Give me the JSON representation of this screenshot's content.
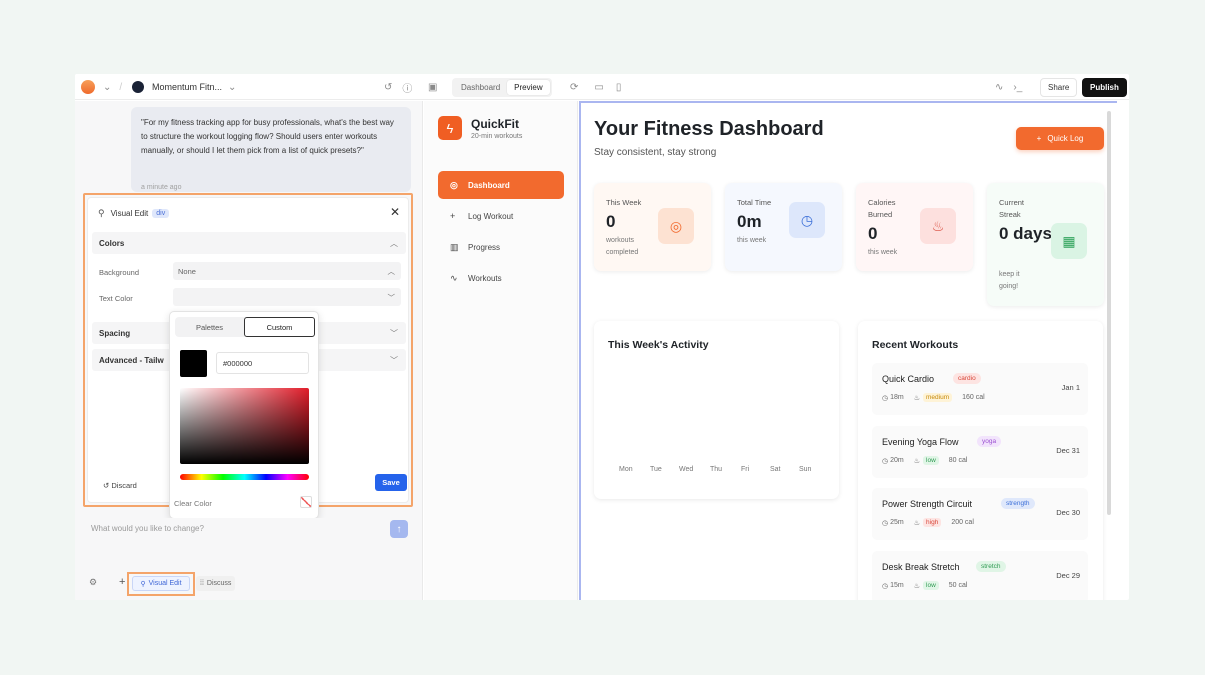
{
  "topbar": {
    "project_name": "Momentum Fitn...",
    "tabs": [
      "Dashboard",
      "Preview"
    ],
    "share": "Share",
    "publish": "Publish"
  },
  "chat": {
    "message": "\"For my fitness tracking app for busy professionals, what's the best way to structure the workout logging flow? Should users enter workouts manually, or should I let them pick from a list of quick presets?\"",
    "time": "a minute ago"
  },
  "visual_edit": {
    "title": "Visual Edit",
    "tag": "div",
    "sections": {
      "colors": "Colors",
      "spacing": "Spacing",
      "advanced": "Advanced - Tailw"
    },
    "background_label": "Background",
    "background_value": "None",
    "text_color_label": "Text Color",
    "discard": "Discard",
    "save": "Save",
    "picker": {
      "tabs": [
        "Palettes",
        "Custom"
      ],
      "hex": "#000000",
      "clear": "Clear Color",
      "color": "#000000"
    }
  },
  "prompt": {
    "placeholder": "What would you like to change?",
    "visual_edit_btn": "Visual Edit",
    "discuss_btn": "Discuss"
  },
  "app": {
    "brand": "QuickFit",
    "brand_sub": "20-min workouts",
    "nav": [
      "Dashboard",
      "Log Workout",
      "Progress",
      "Workouts"
    ],
    "title": "Your Fitness Dashboard",
    "subtitle": "Stay consistent, stay strong",
    "quick_log": "Quick Log",
    "stats": [
      {
        "label": "This Week",
        "value": "0",
        "sub": "workouts completed"
      },
      {
        "label": "Total Time",
        "value": "0m",
        "sub": "this week"
      },
      {
        "label": "Calories Burned",
        "value": "0",
        "sub": "this week"
      },
      {
        "label": "Current Streak",
        "value": "0 days",
        "sub": "keep it going!"
      }
    ],
    "activity_title": "This Week's Activity",
    "days": [
      "Mon",
      "Tue",
      "Wed",
      "Thu",
      "Fri",
      "Sat",
      "Sun"
    ],
    "recent_title": "Recent Workouts",
    "workouts": [
      {
        "name": "Quick Cardio",
        "tag": "cardio",
        "time": "18m",
        "level": "medium",
        "cal": "160 cal",
        "date": "Jan 1"
      },
      {
        "name": "Evening Yoga Flow",
        "tag": "yoga",
        "time": "20m",
        "level": "low",
        "cal": "80 cal",
        "date": "Dec 31"
      },
      {
        "name": "Power Strength Circuit",
        "tag": "strength",
        "time": "25m",
        "level": "high",
        "cal": "200 cal",
        "date": "Dec 30"
      },
      {
        "name": "Desk Break Stretch",
        "tag": "stretch",
        "time": "15m",
        "level": "low",
        "cal": "50 cal",
        "date": "Dec 29"
      }
    ]
  },
  "colors": {
    "accent": "#f26a2e",
    "primary": "#2563eb"
  }
}
